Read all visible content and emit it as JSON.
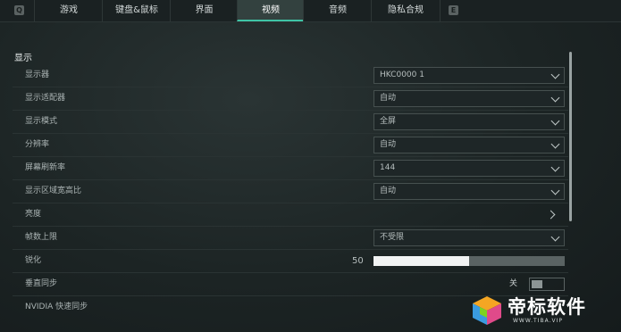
{
  "keyhints": {
    "left": "Q",
    "right": "E"
  },
  "tabs": [
    {
      "label": "游戏",
      "active": false
    },
    {
      "label": "键盘&鼠标",
      "active": false
    },
    {
      "label": "界面",
      "active": false
    },
    {
      "label": "视频",
      "active": true
    },
    {
      "label": "音频",
      "active": false
    },
    {
      "label": "隐私合规",
      "active": false
    }
  ],
  "section": {
    "title": "显示"
  },
  "settings": [
    {
      "label": "显示器",
      "control": "dropdown",
      "value": "HKC0000 1"
    },
    {
      "label": "显示适配器",
      "control": "dropdown",
      "value": "自动"
    },
    {
      "label": "显示模式",
      "control": "dropdown",
      "value": "全屏"
    },
    {
      "label": "分辨率",
      "control": "dropdown",
      "value": "自动"
    },
    {
      "label": "屏幕刷新率",
      "control": "dropdown",
      "value": "144"
    },
    {
      "label": "显示区域宽高比",
      "control": "dropdown",
      "value": "自动"
    },
    {
      "label": "亮度",
      "control": "link"
    },
    {
      "label": "帧数上限",
      "control": "dropdown",
      "value": "不受限"
    },
    {
      "label": "锐化",
      "control": "slider",
      "value": "50",
      "percent": 50
    },
    {
      "label": "垂直同步",
      "control": "toggle",
      "value": "关"
    },
    {
      "label": "NVIDIA 快速同步",
      "control": "none"
    }
  ],
  "watermark": {
    "title": "帝标软件",
    "subtitle": "WWW.TIBA.VIP"
  },
  "colors": {
    "accent": "#3fc4a6",
    "background": "#1c2424"
  }
}
